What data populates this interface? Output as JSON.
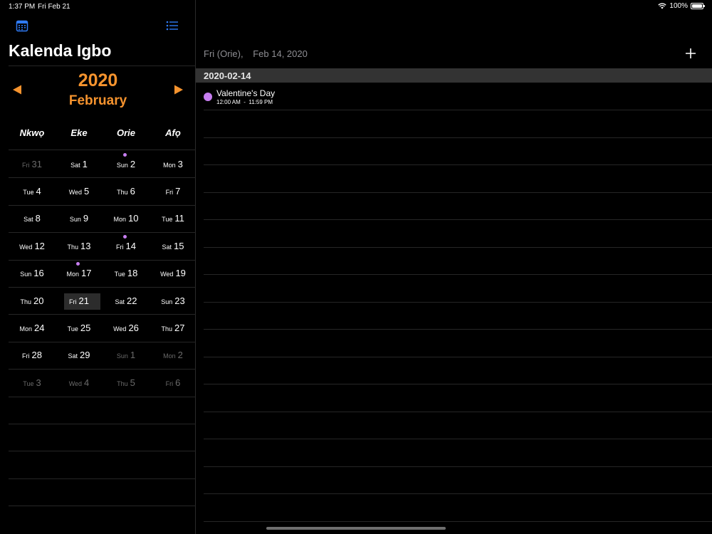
{
  "status_bar": {
    "time": "1:37 PM",
    "date": "Fri Feb 21",
    "battery": "100%",
    "battery_level": 1.0
  },
  "sidebar": {
    "app_title": "Kalenda Igbo",
    "year": "2020",
    "month": "February",
    "icons": {
      "calendar": "calendar-icon",
      "list": "list-icon",
      "prev": "triangle-left-icon",
      "next": "triangle-right-icon"
    },
    "day_headers": [
      "Nkwọ",
      "Eke",
      "Orie",
      "Afọ"
    ],
    "weeks": [
      [
        {
          "wd": "Fri",
          "d": "31",
          "dim": true
        },
        {
          "wd": "Sat",
          "d": "1"
        },
        {
          "wd": "Sun",
          "d": "2",
          "event": true
        },
        {
          "wd": "Mon",
          "d": "3"
        }
      ],
      [
        {
          "wd": "Tue",
          "d": "4"
        },
        {
          "wd": "Wed",
          "d": "5"
        },
        {
          "wd": "Thu",
          "d": "6"
        },
        {
          "wd": "Fri",
          "d": "7"
        }
      ],
      [
        {
          "wd": "Sat",
          "d": "8"
        },
        {
          "wd": "Sun",
          "d": "9"
        },
        {
          "wd": "Mon",
          "d": "10"
        },
        {
          "wd": "Tue",
          "d": "11"
        }
      ],
      [
        {
          "wd": "Wed",
          "d": "12"
        },
        {
          "wd": "Thu",
          "d": "13"
        },
        {
          "wd": "Fri",
          "d": "14",
          "event": true
        },
        {
          "wd": "Sat",
          "d": "15"
        }
      ],
      [
        {
          "wd": "Sun",
          "d": "16"
        },
        {
          "wd": "Mon",
          "d": "17",
          "event": true
        },
        {
          "wd": "Tue",
          "d": "18"
        },
        {
          "wd": "Wed",
          "d": "19"
        }
      ],
      [
        {
          "wd": "Thu",
          "d": "20"
        },
        {
          "wd": "Fri",
          "d": "21",
          "today": true
        },
        {
          "wd": "Sat",
          "d": "22"
        },
        {
          "wd": "Sun",
          "d": "23"
        }
      ],
      [
        {
          "wd": "Mon",
          "d": "24"
        },
        {
          "wd": "Tue",
          "d": "25"
        },
        {
          "wd": "Wed",
          "d": "26"
        },
        {
          "wd": "Thu",
          "d": "27"
        }
      ],
      [
        {
          "wd": "Fri",
          "d": "28"
        },
        {
          "wd": "Sat",
          "d": "29"
        },
        {
          "wd": "Sun",
          "d": "1",
          "dim": true
        },
        {
          "wd": "Mon",
          "d": "2",
          "dim": true
        }
      ],
      [
        {
          "wd": "Tue",
          "d": "3",
          "dim": true
        },
        {
          "wd": "Wed",
          "d": "4",
          "dim": true
        },
        {
          "wd": "Thu",
          "d": "5",
          "dim": true
        },
        {
          "wd": "Fri",
          "d": "6",
          "dim": true
        }
      ]
    ]
  },
  "detail": {
    "day_label": "Fri (Orie),",
    "date_label": "Feb 14, 2020",
    "add_icon": "plus-icon",
    "section_header": "2020-02-14",
    "events": [
      {
        "title": "Valentine's Day",
        "time": "12:00 AM  -  11:59 PM",
        "color": "#c77ef0"
      }
    ]
  },
  "colors": {
    "accent": "#f5932e",
    "event": "#c77ef0",
    "icon_blue": "#2f7bf5"
  }
}
